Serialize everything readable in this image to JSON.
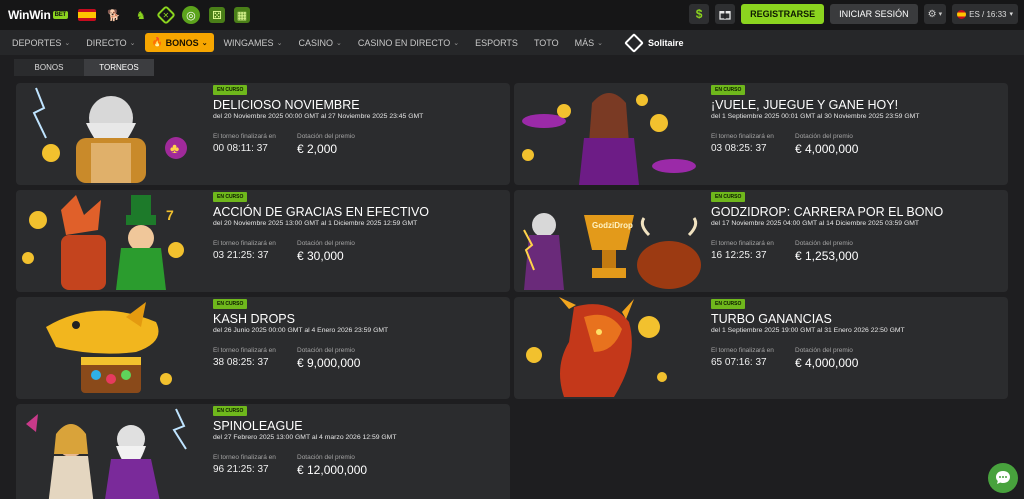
{
  "topbar": {
    "logo_text": "WinWin",
    "logo_badge": "BET",
    "icons": [
      "spain-flag-icon",
      "dog-icon",
      "horse-icon",
      "shield-x-icon",
      "globe-icon",
      "dice-icon",
      "ticket-icon"
    ],
    "dollar_icon": "$",
    "gift_icon": "gift-icon",
    "register_label": "REGISTRARSE",
    "login_label": "INICIAR SESIÓN",
    "lang_time": "ES / 16:33"
  },
  "nav": [
    {
      "label": "DEPORTES",
      "has_chevron": true
    },
    {
      "label": "DIRECTO",
      "has_chevron": true
    },
    {
      "label": "BONOS",
      "has_chevron": true,
      "active": true
    },
    {
      "label": "WINGAMES",
      "has_chevron": true
    },
    {
      "label": "CASINO",
      "has_chevron": true
    },
    {
      "label": "CASINO EN DIRECTO",
      "has_chevron": true
    },
    {
      "label": "ESPORTS",
      "has_chevron": false
    },
    {
      "label": "TOTO",
      "has_chevron": false
    },
    {
      "label": "MÁS",
      "has_chevron": true
    }
  ],
  "nav_solitaire": "Solitaire",
  "tabs": [
    {
      "label": "BONOS",
      "active": false
    },
    {
      "label": "TORNEOS",
      "active": true
    }
  ],
  "label_ends": "El torneo finalizará en",
  "label_prize": "Dotación del premio",
  "tournaments": [
    {
      "badge": "EN CURSO",
      "title": "DELICIOSO NOVIEMBRE",
      "dates": "del 20 Noviembre 2025 00:00 GMT al 27 Noviembre 2025 23:45 GMT",
      "countdown": "00 08:11: 37",
      "prize": "€ 2,000",
      "art": "zeus-thunder-art"
    },
    {
      "badge": "EN CURSO",
      "title": "¡VUELE, JUEGUE Y GANE HOY!",
      "dates": "del 1 Septiembre 2025 00:01 GMT al 30 Noviembre 2025 23:59 GMT",
      "countdown": "03 08:25: 37",
      "prize": "€ 4,000,000",
      "art": "aviator-pilot-art"
    },
    {
      "badge": "EN CURSO",
      "title": "ACCIÓN DE GRACIAS EN EFECTIVO",
      "dates": "del 20 Noviembre 2025 13:00 GMT al 1 Diciembre 2025 12:59 GMT",
      "countdown": "03 21:25: 37",
      "prize": "€ 30,000",
      "art": "fox-leprechaun-art"
    },
    {
      "badge": "EN CURSO",
      "title": "GODZIDROP: CARRERA POR EL BONO",
      "dates": "del 17 Noviembre 2025 04:00 GMT al 14 Diciembre 2025 03:59 GMT",
      "countdown": "16 12:25: 37",
      "prize": "€ 1,253,000",
      "art": "godzidrop-trophy-art"
    },
    {
      "badge": "EN CURSO",
      "title": "KASH DROPS",
      "dates": "del 26 Junio 2025 00:00 GMT al 4 Enero 2026 23:59 GMT",
      "countdown": "38 08:25: 37",
      "prize": "€ 9,000,000",
      "art": "dolphin-treasure-art"
    },
    {
      "badge": "EN CURSO",
      "title": "TURBO GANANCIAS",
      "dates": "del 1 Septiembre 2025 19:00 GMT al 31 Enero 2026 22:50 GMT",
      "countdown": "65 07:16: 37",
      "prize": "€ 4,000,000",
      "art": "fire-dragon-art"
    },
    {
      "badge": "EN CURSO",
      "title": "SPINOLEAGUE",
      "dates": "del 27 Febrero 2025 13:00 GMT al 4 marzo 2026 12:59 GMT",
      "countdown": "96 21:25: 37",
      "prize": "€ 12,000,000",
      "art": "gods-duo-art"
    }
  ],
  "colors": {
    "accent": "#8bd41f",
    "active_nav": "#f7a600",
    "card_bg": "#2b2c2e",
    "page_bg": "#1e1e20",
    "badge": "#6fb81c"
  },
  "chat_icon": "chat-bubble-icon"
}
